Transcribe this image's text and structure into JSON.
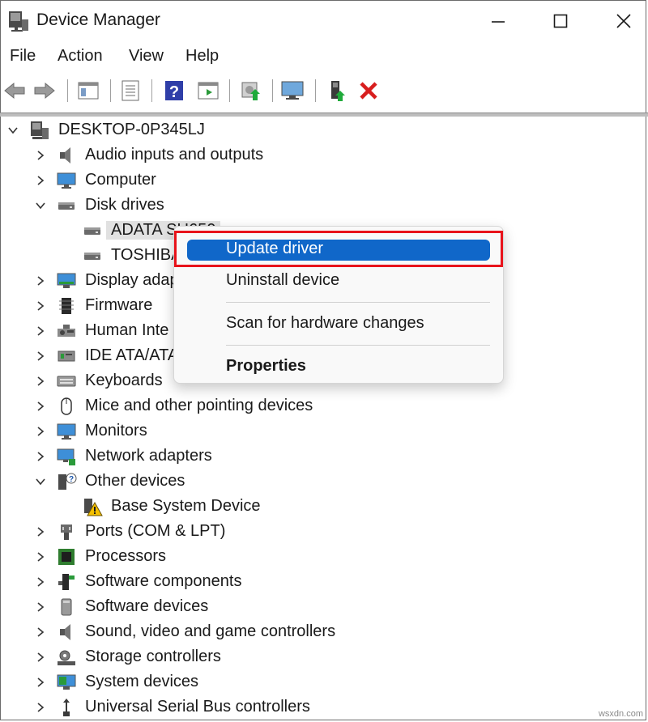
{
  "window": {
    "title": "Device Manager"
  },
  "menu": {
    "file": "File",
    "action": "Action",
    "view": "View",
    "help": "Help"
  },
  "tree": {
    "root": "DESKTOP-0P345LJ",
    "items": [
      {
        "label": "Audio inputs and outputs"
      },
      {
        "label": "Computer"
      },
      {
        "label": "Disk drives"
      },
      {
        "label": "ADATA SU650"
      },
      {
        "label": "TOSHIBA"
      },
      {
        "label": "Display adap"
      },
      {
        "label": "Firmware"
      },
      {
        "label": "Human Inte"
      },
      {
        "label": "IDE ATA/ATA"
      },
      {
        "label": "Keyboards"
      },
      {
        "label": "Mice and other pointing devices"
      },
      {
        "label": "Monitors"
      },
      {
        "label": "Network adapters"
      },
      {
        "label": "Other devices"
      },
      {
        "label": "Base System Device"
      },
      {
        "label": "Ports (COM & LPT)"
      },
      {
        "label": "Processors"
      },
      {
        "label": "Software components"
      },
      {
        "label": "Software devices"
      },
      {
        "label": "Sound, video and game controllers"
      },
      {
        "label": "Storage controllers"
      },
      {
        "label": "System devices"
      },
      {
        "label": "Universal Serial Bus controllers"
      }
    ]
  },
  "context_menu": {
    "update_driver": "Update driver",
    "uninstall_device": "Uninstall device",
    "scan_hardware": "Scan for hardware changes",
    "properties": "Properties"
  },
  "colors": {
    "highlight": "#1067c9",
    "annotation": "#e8131b",
    "delete_icon": "#d81e1e"
  },
  "watermark": "wsxdn.com"
}
